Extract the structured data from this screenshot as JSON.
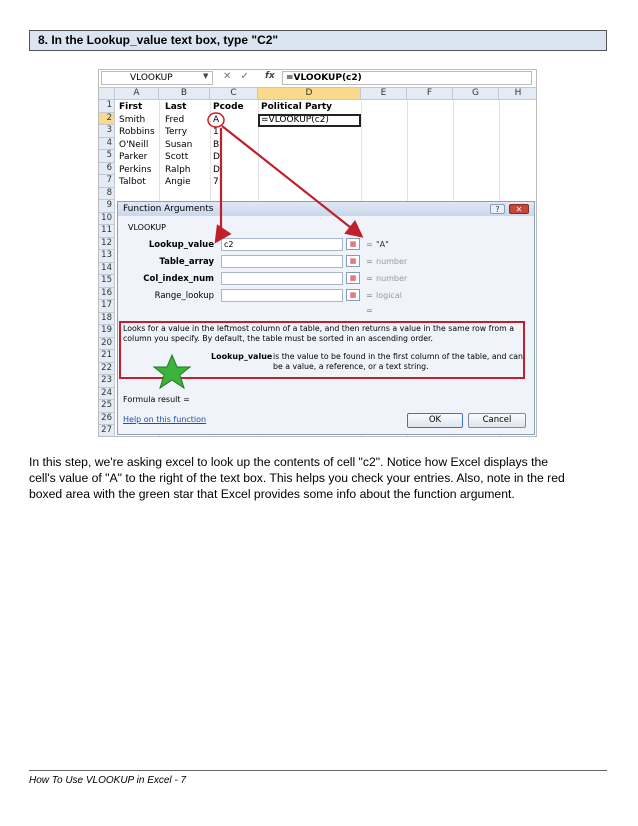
{
  "step_heading": "8. In the Lookup_value text box, type \"C2\"",
  "excel": {
    "name_box": "VLOOKUP",
    "formula_bar_icons": "✕ ✓",
    "fx_label": "fx",
    "formula": "=VLOOKUP(c2)",
    "columns": [
      "A",
      "B",
      "C",
      "D",
      "E",
      "F",
      "G",
      "H"
    ],
    "rows": [
      "1",
      "2",
      "3",
      "4",
      "5",
      "6",
      "7",
      "8",
      "9",
      "10",
      "11",
      "12",
      "13",
      "14",
      "15",
      "16",
      "17",
      "18",
      "19",
      "20",
      "21",
      "22",
      "23",
      "24",
      "25",
      "26",
      "27"
    ],
    "cells": {
      "A1": "First",
      "B1": "Last",
      "C1": "Pcode",
      "D1": "Political Party",
      "A2": "Smith",
      "B2": "Fred",
      "C2": "A",
      "D2": "=VLOOKUP(c2)",
      "A3": "Robbins",
      "B3": "Terry",
      "C3": "1",
      "A4": "O'Neill",
      "B4": "Susan",
      "C4": "B",
      "A5": "Parker",
      "B5": "Scott",
      "C5": "D",
      "A6": "Perkins",
      "B6": "Ralph",
      "C6": "D",
      "A7": "Talbot",
      "B7": "Angie",
      "C7": "7"
    }
  },
  "dialog": {
    "title": "Function Arguments",
    "help_button": "?",
    "close_button": "✕",
    "function_name": "VLOOKUP",
    "args": [
      {
        "label": "Lookup_value",
        "value": "c2",
        "result": "\"A\""
      },
      {
        "label": "Table_array",
        "value": "",
        "result": "number"
      },
      {
        "label": "Col_index_num",
        "value": "",
        "result": "number"
      },
      {
        "label": "Range_lookup",
        "value": "",
        "result": "logical"
      }
    ],
    "equals": "=",
    "trailing_equals": "=",
    "description": "Looks for a value in the leftmost column of a table, and then returns a value in the same row from a column you specify. By default, the table must be sorted in an ascending order.",
    "arg_desc_name": "Lookup_value",
    "arg_desc_text": "is the value to be found in the first column of the table, and can be a value, a reference, or a text string.",
    "formula_result": "Formula result =",
    "help_link": "Help on this function",
    "ok": "OK",
    "cancel": "Cancel"
  },
  "annotation_colors": {
    "arrow": "#c0202b",
    "star": "#3cb43c"
  },
  "paragraph": [
    "In this step, we're asking excel to look up the contents of cell \"c2\". Notice how Excel displays the",
    "cell's value of \"A\" to the right of the text box. This helps you check your entries. Also, note in the red",
    "boxed area with the green star that Excel provides some info about the function argument."
  ],
  "footer": "How To Use VLOOKUP in Excel  - 7"
}
